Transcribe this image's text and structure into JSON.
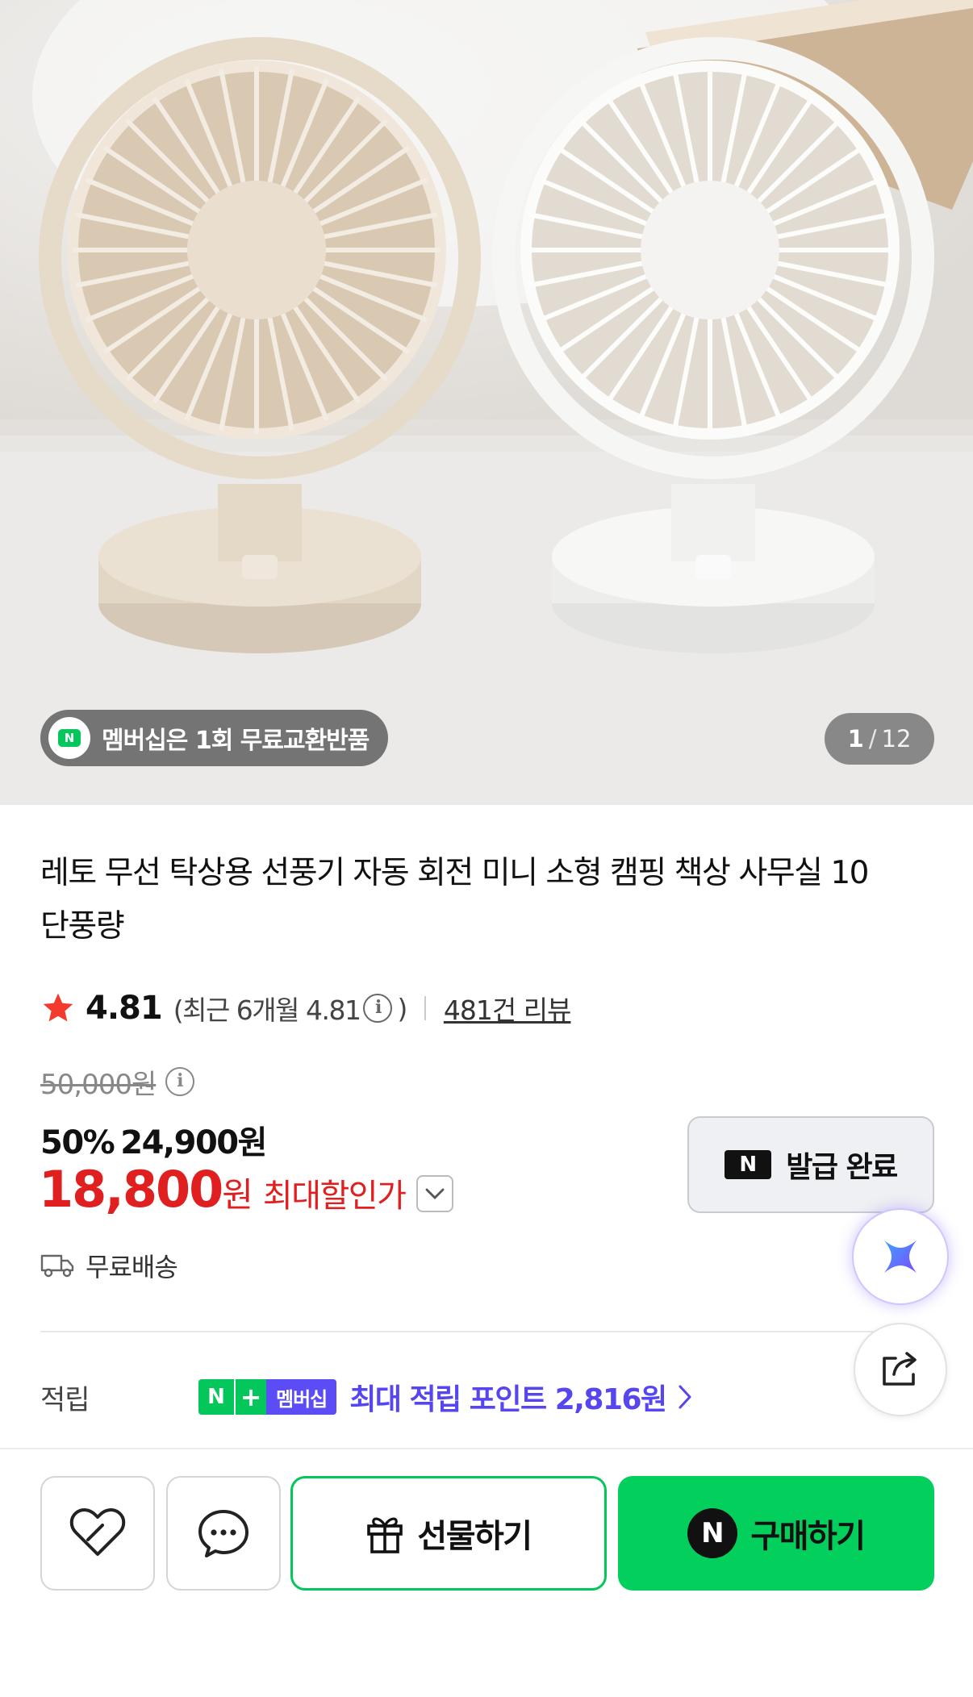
{
  "hero": {
    "image_subject": "two desk fans beige and white",
    "membership_badge": "멤버십은 1회 무료교환반품",
    "membership_badge_icon": "n-delivery-icon",
    "counter_current": "1",
    "counter_separator": "/",
    "counter_total": "12"
  },
  "product": {
    "title": "레토 무선 탁상용 선풍기 자동 회전 미니 소형 캠핑 책상 사무실 10단풍량"
  },
  "rating": {
    "score": "4.81",
    "recent_prefix": "(최근 6개월 4.81",
    "recent_suffix": ")",
    "review_link": "481건 리뷰"
  },
  "price": {
    "original": "50,000원",
    "discount_percent": "50%",
    "discount_price": "24,900원",
    "final_number": "18,800",
    "final_unit": "원",
    "final_label": "최대할인가"
  },
  "coupon": {
    "logo": "N",
    "label": "발급 완료"
  },
  "shipping": {
    "label": "무료배송"
  },
  "points": {
    "label": "적립",
    "badge_n": "N",
    "badge_plus": "+",
    "badge_membership": "멤버십",
    "value": "최대 적립 포인트 2,816원"
  },
  "actions": {
    "gift_label": "선물하기",
    "buy_logo": "N",
    "buy_label": "구매하기"
  },
  "colors": {
    "naver_green": "#03c75a",
    "sale_red": "#e02020",
    "membership_purple": "#5546f0"
  }
}
